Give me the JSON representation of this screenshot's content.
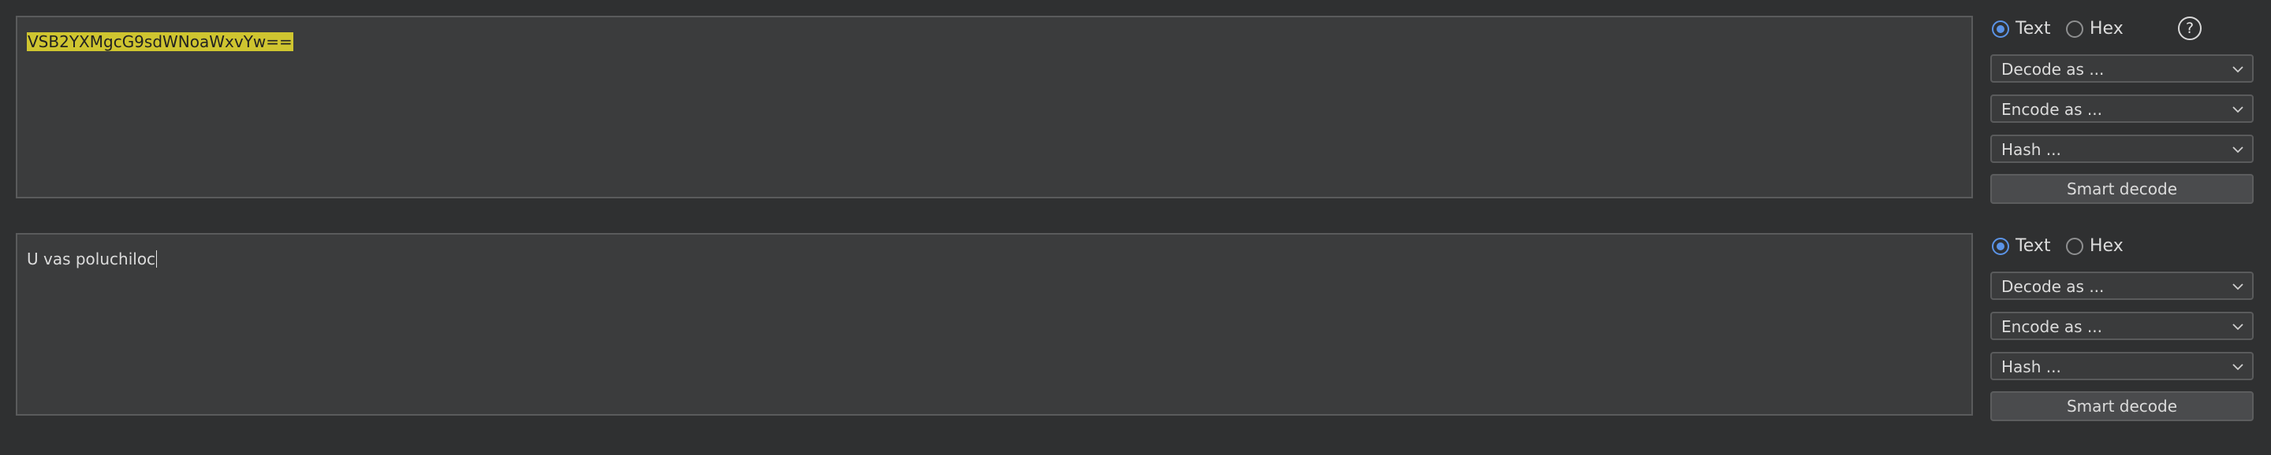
{
  "panels": [
    {
      "input_text": "VSB2YXMgcG9sdWNoaWxvYw==",
      "radio_text_label": "Text",
      "radio_hex_label": "Hex",
      "selected_format": "Text",
      "decode_label": "Decode as ...",
      "encode_label": "Encode as ...",
      "hash_label": "Hash ...",
      "smart_decode_label": "Smart decode",
      "help_icon_glyph": "?"
    },
    {
      "input_text": "U vas poluchiloc",
      "radio_text_label": "Text",
      "radio_hex_label": "Hex",
      "selected_format": "Text",
      "decode_label": "Decode as ...",
      "encode_label": "Encode as ...",
      "hash_label": "Hash ...",
      "smart_decode_label": "Smart decode"
    }
  ],
  "colors": {
    "background": "#2f3031",
    "text_area_bg": "#3b3c3d",
    "selection_highlight": "#cfc530",
    "radio_selected": "#5b93e6"
  },
  "icons": {
    "help": "help-icon",
    "chevron": "chevron-down-icon"
  }
}
